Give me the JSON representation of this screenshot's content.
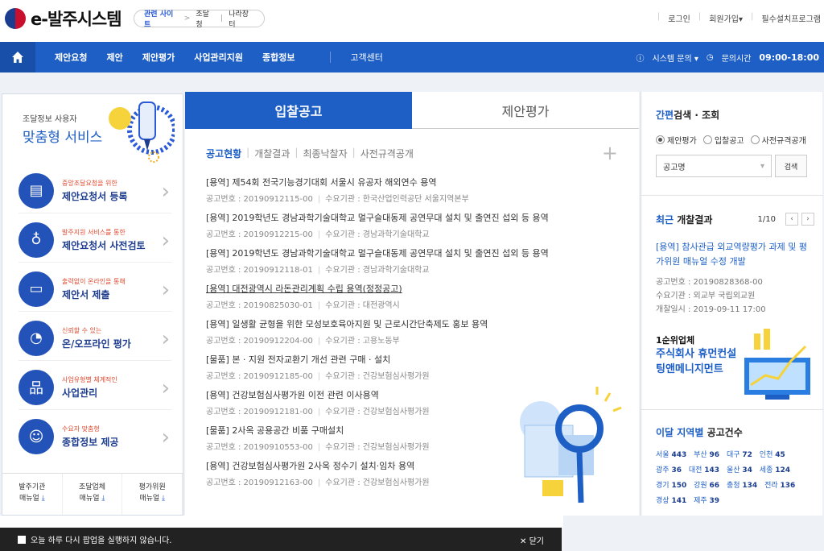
{
  "header": {
    "logo_text": "e-발주시스템",
    "related_label": "관련 사이트",
    "related_arrow": ">",
    "related_links": [
      "조달청",
      "나라장터"
    ],
    "top_menu": [
      "로그인",
      "회원가입▾",
      "필수설치프로그램"
    ]
  },
  "nav": {
    "items": [
      "제안요청",
      "제안",
      "제안평가",
      "사업관리지원",
      "종합정보",
      "고객센터"
    ],
    "system_inquiry": "시스템 문의 ▾",
    "inquiry_time_label": "문의시간",
    "inquiry_time": "09:00-18:00"
  },
  "left": {
    "sub": "조달정보 사용자",
    "title": "맞춤형 서비스",
    "services": [
      {
        "sub": "중앙조달요청을 위한",
        "title": "제안요청서 등록"
      },
      {
        "sub": "발주지원 서비스를 통한",
        "title": "제안요청서 사전검토"
      },
      {
        "sub": "출력없이 온라인을 통해",
        "title": "제안서 제출"
      },
      {
        "sub": "신뢰할 수 있는",
        "title": "온/오프라인 평가"
      },
      {
        "sub": "사업유형별 체계적인",
        "title": "사업관리"
      },
      {
        "sub": "수요자 맞춤형",
        "title": "종합정보 제공"
      }
    ],
    "manuals": [
      {
        "line1": "발주기관",
        "line2": "매뉴얼"
      },
      {
        "line1": "조달업체",
        "line2": "매뉴얼"
      },
      {
        "line1": "평가위원",
        "line2": "매뉴얼"
      }
    ]
  },
  "center": {
    "tabs": [
      "입찰공고",
      "제안평가"
    ],
    "subtabs": [
      "공고현황",
      "개찰결과",
      "최종낙찰자",
      "사전규격공개"
    ],
    "notices": [
      {
        "title": "[용역] 제54회 전국기능경기대회 서울시 유공자 해외연수 용역",
        "no": "공고번호 : 20190912115-00",
        "agency": "수요기관 : 한국산업인력공단 서울지역본부"
      },
      {
        "title": "[용역] 2019학년도 경남과학기술대학교 멀구슬대동제 공연무대 설치 및 출연진 섭외 등 용역",
        "no": "공고번호 : 20190912215-00",
        "agency": "수요기관 : 경남과학기술대학교"
      },
      {
        "title": "[용역] 2019학년도 경남과학기술대학교 멀구슬대동제 공연무대 설치 및 출연진 섭외 등 용역",
        "no": "공고번호 : 20190912118-01",
        "agency": "수요기관 : 경남과학기술대학교"
      },
      {
        "title": "[용역] 대전광역시 라돈관리계획 수립 용역(정정공고)",
        "no": "공고번호 : 20190825030-01",
        "agency": "수요기관 : 대전광역시"
      },
      {
        "title": "[용역] 일생활 균형을 위한 모성보호육아지원 및 근로시간단축제도 홍보 용역",
        "no": "공고번호 : 20190912204-00",
        "agency": "수요기관 : 고용노동부"
      },
      {
        "title": "[물품] 본 · 지원 전자교환기 개선 관련 구매 · 설치",
        "no": "공고번호 : 20190912185-00",
        "agency": "수요기관 : 건강보험심사평가원"
      },
      {
        "title": "[용역] 건강보험심사평가원 이전 관련 이사용역",
        "no": "공고번호 : 20190912181-00",
        "agency": "수요기관 : 건강보험심사평가원"
      },
      {
        "title": "[물품] 2사옥 공용공간 비품 구매설치",
        "no": "공고번호 : 20190910553-00",
        "agency": "수요기관 : 건강보험심사평가원"
      },
      {
        "title": "[용역] 건강보험심사평가원 2사옥 정수기 설치·임차 용역",
        "no": "공고번호 : 20190912163-00",
        "agency": "수요기관 : 건강보험심사평가원"
      }
    ]
  },
  "right": {
    "quick_title_a": "간편",
    "quick_title_b": "검색 · 조회",
    "radios": [
      "제안평가",
      "입찰공고",
      "사전규격공개"
    ],
    "select_value": "공고명",
    "search_button": "검색",
    "recent_title_a": "최근",
    "recent_title_b": " 개찰결과",
    "page": "1/10",
    "recent_link": "[용역] 참사관급 외교역량평가 과제 및 평가위원 매뉴얼 수정 개발",
    "recent_no": "공고번호 : 20190828368-00",
    "recent_agency": "수요기관 : 외교부 국립외교원",
    "recent_date": "개찰일시 : 2019-09-11 17:00",
    "rank_label": "1순위업체",
    "company": "주식회사 휴먼컨설팅앤메니지먼트",
    "company_l1": "주식회사 휴먼컨설",
    "company_l2": "팅앤메니지먼트",
    "region_title_a": "이달 지역별",
    "region_title_b": " 공고건수",
    "regions": [
      [
        [
          "서울",
          "443"
        ],
        [
          "부산",
          "96"
        ],
        [
          "대구",
          "72"
        ],
        [
          "인천",
          "45"
        ]
      ],
      [
        [
          "광주",
          "36"
        ],
        [
          "대전",
          "143"
        ],
        [
          "울산",
          "34"
        ],
        [
          "세종",
          "124"
        ]
      ],
      [
        [
          "경기",
          "150"
        ],
        [
          "강원",
          "66"
        ],
        [
          "충청",
          "134"
        ],
        [
          "전라",
          "136"
        ]
      ],
      [
        [
          "경상",
          "141"
        ],
        [
          "제주",
          "39"
        ]
      ]
    ]
  },
  "popup": {
    "text": "오늘 하루 다시 팝업을 실행하지 않습니다.",
    "close": "닫기"
  },
  "colors": {
    "primary": "#1e5fc5",
    "accent": "#e04a2f"
  }
}
